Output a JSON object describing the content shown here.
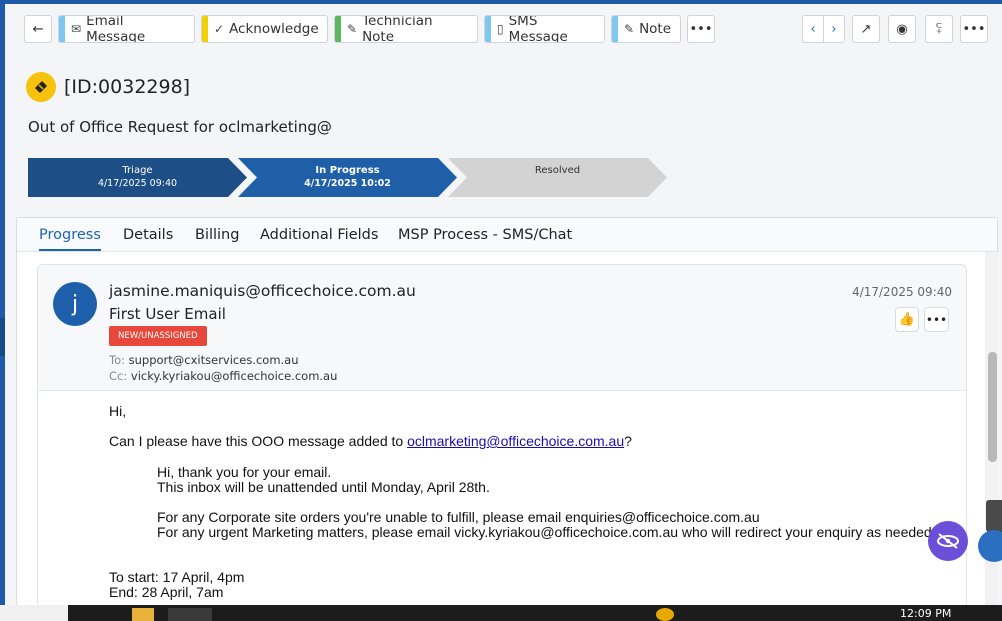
{
  "toolbar": {
    "buttons": [
      {
        "label": "Email Message",
        "color": "#7cc8f0",
        "icon": "envelope-icon"
      },
      {
        "label": "Acknowledge",
        "color": "#f0d000",
        "icon": "acknowledge-icon"
      },
      {
        "label": "Technician Note",
        "color": "#5cb85c",
        "icon": "note-edit-icon"
      },
      {
        "label": "SMS Message",
        "color": "#7cc8f0",
        "icon": "mobile-icon"
      },
      {
        "label": "Note",
        "color": "#7cc8f0",
        "icon": "edit-icon"
      }
    ]
  },
  "ticket": {
    "id": "[ID:0032298]",
    "subject": "Out of Office Request for oclmarketing@"
  },
  "stages": [
    {
      "name": "Triage",
      "date": "4/17/2025 09:40",
      "color": "#1d4e86"
    },
    {
      "name": "In Progress",
      "date": "4/17/2025 10:02",
      "color": "#1f5fa8"
    },
    {
      "name": "Resolved",
      "date": "",
      "color": "#d3d3d3"
    }
  ],
  "tabs": [
    "Progress",
    "Details",
    "Billing",
    "Additional Fields",
    "MSP Process - SMS/Chat"
  ],
  "email": {
    "avatar_letter": "j",
    "from": "jasmine.maniquis@officechoice.com.au",
    "title": "First User Email",
    "badge": "NEW/UNASSIGNED",
    "to_label": "To:",
    "to": "support@cxitservices.com.au",
    "cc_label": "Cc:",
    "cc": "vicky.kyriakou@officechoice.com.au",
    "date": "4/17/2025 09:40",
    "greeting": "Hi,",
    "request_prefix": "Can I please have this OOO message added to ",
    "request_link": "oclmarketing@officechoice.com.au",
    "request_suffix": "?",
    "ooo_1": "Hi, thank you for your email.",
    "ooo_2": "This inbox will be unattended until Monday, April 28th.",
    "ooo_3": "For any Corporate site orders you're unable to fulfill, please email enquiries@officechoice.com.au",
    "ooo_4": "For any urgent Marketing matters, please email vicky.kyriakou@officechoice.com.au who will redirect your enquiry as needed.",
    "start": "To start: 17 April, 4pm",
    "end": "End: 28 April, 7am"
  },
  "taskbar": {
    "clock": "12:09 PM"
  }
}
